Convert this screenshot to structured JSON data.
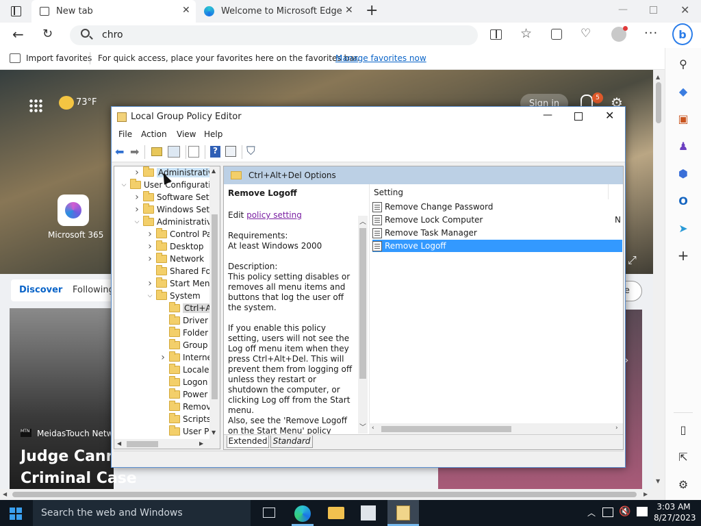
{
  "browser": {
    "tabs": [
      {
        "label": "New tab",
        "icon": "new-tab-icon"
      },
      {
        "label": "Welcome to Microsoft Edge",
        "icon": "edge-icon"
      }
    ],
    "address_value": "chro",
    "favbar": {
      "import_label": "Import favorites",
      "prompt": "For quick access, place your favorites here on the favorites bar.",
      "manage_link": "Manage favorites now"
    }
  },
  "newtab": {
    "weather": "73°F",
    "signin": "Sign in",
    "notif_count": "5",
    "m365_label": "Microsoft 365",
    "feed_tabs": [
      "Discover",
      "Following"
    ],
    "personalize_partial": "ze",
    "news_source": "MeidasTouch Netwo",
    "headline_line1": "Judge Cann",
    "headline_line2": "Criminal Case"
  },
  "gpedit": {
    "title": "Local Group Policy Editor",
    "menu": [
      "File",
      "Action",
      "View",
      "Help"
    ],
    "tree": [
      {
        "label": "Administrative",
        "arrow": "right",
        "indent": 1,
        "selected": false,
        "hover": true
      },
      {
        "label": "User Configuratio",
        "arrow": "down",
        "indent": 0,
        "selected": false
      },
      {
        "label": "Software Setti",
        "arrow": "right",
        "indent": 1,
        "selected": false
      },
      {
        "label": "Windows Sett",
        "arrow": "right",
        "indent": 1,
        "selected": false
      },
      {
        "label": "Administrative",
        "arrow": "down",
        "indent": 1,
        "selected": false
      },
      {
        "label": "Control Pa",
        "arrow": "right",
        "indent": 2,
        "selected": false
      },
      {
        "label": "Desktop",
        "arrow": "right",
        "indent": 2,
        "selected": false
      },
      {
        "label": "Network",
        "arrow": "right",
        "indent": 2,
        "selected": false
      },
      {
        "label": "Shared Fol",
        "arrow": "",
        "indent": 2,
        "selected": false
      },
      {
        "label": "Start Menu",
        "arrow": "right",
        "indent": 2,
        "selected": false
      },
      {
        "label": "System",
        "arrow": "down",
        "indent": 2,
        "selected": false
      },
      {
        "label": "Ctrl+A",
        "arrow": "",
        "indent": 3,
        "selected": true
      },
      {
        "label": "Driver",
        "arrow": "",
        "indent": 3,
        "selected": false
      },
      {
        "label": "Folder",
        "arrow": "",
        "indent": 3,
        "selected": false
      },
      {
        "label": "Group",
        "arrow": "",
        "indent": 3,
        "selected": false
      },
      {
        "label": "Interne",
        "arrow": "right",
        "indent": 3,
        "selected": false
      },
      {
        "label": "Locale",
        "arrow": "",
        "indent": 3,
        "selected": false
      },
      {
        "label": "Logon",
        "arrow": "",
        "indent": 3,
        "selected": false
      },
      {
        "label": "Power",
        "arrow": "",
        "indent": 3,
        "selected": false
      },
      {
        "label": "Remov",
        "arrow": "",
        "indent": 3,
        "selected": false
      },
      {
        "label": "Scripts",
        "arrow": "",
        "indent": 3,
        "selected": false
      },
      {
        "label": "User Pr",
        "arrow": "",
        "indent": 3,
        "selected": false
      }
    ],
    "header": "Ctrl+Alt+Del Options",
    "desc": {
      "title": "Remove Logoff",
      "edit_prefix": "Edit",
      "edit_link": "policy setting",
      "req_label": "Requirements:",
      "req_value": "At least Windows 2000",
      "desc_label": "Description:",
      "desc_p1": "This policy setting disables or removes all menu items and buttons that log the user off the system.",
      "desc_p2": "If you enable this policy setting, users will not see the Log off menu item when they press Ctrl+Alt+Del. This will prevent them from logging off unless they restart or shutdown the computer, or clicking Log off from the Start menu.",
      "desc_p3": "Also, see the 'Remove Logoff on the Start Menu' policy setting."
    },
    "list_header": "Setting",
    "list_state_partial": "N",
    "settings": [
      "Remove Change Password",
      "Remove Lock Computer",
      "Remove Task Manager",
      "Remove Logoff"
    ],
    "selected_setting": "Remove Logoff",
    "view_tabs": [
      "Extended",
      "Standard"
    ]
  },
  "taskbar": {
    "search_placeholder": "Search the web and Windows",
    "time": "3:03 AM",
    "date": "8/27/2023"
  },
  "colors": {
    "selection": "#3399ff",
    "accent": "#0a64c8",
    "link": "#7a1fa2"
  }
}
